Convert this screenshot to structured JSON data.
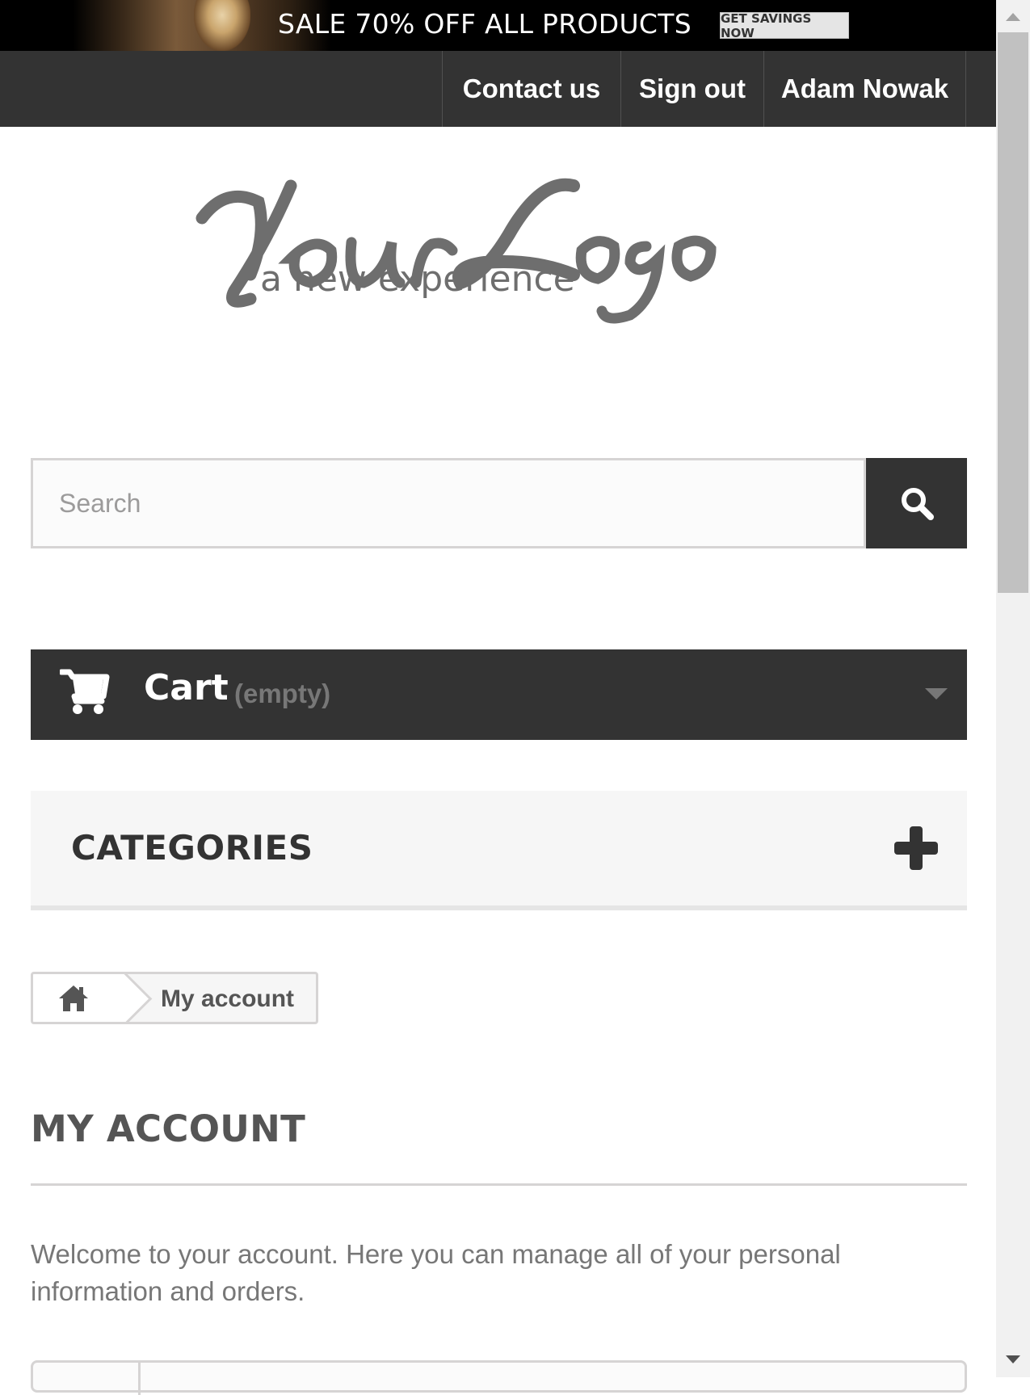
{
  "promo": {
    "headline": "SALE 70% OFF ALL PRODUCTS",
    "button_label": "GET SAVINGS NOW"
  },
  "nav": {
    "contact": "Contact us",
    "signout": "Sign out",
    "user": "Adam Nowak"
  },
  "logo": {
    "wordmark": "YourLogo",
    "tagline": "a new experience"
  },
  "search": {
    "placeholder": "Search"
  },
  "cart": {
    "label": "Cart",
    "status": "(empty)"
  },
  "categories": {
    "title": "CATEGORIES"
  },
  "breadcrumb": {
    "current": "My account"
  },
  "page": {
    "title": "MY ACCOUNT",
    "welcome": "Welcome to your account. Here you can manage all of your personal information and orders."
  },
  "colors": {
    "dark": "#333333",
    "light_bg": "#f6f6f6",
    "border": "#d6d4d4",
    "muted_text": "#777777"
  }
}
